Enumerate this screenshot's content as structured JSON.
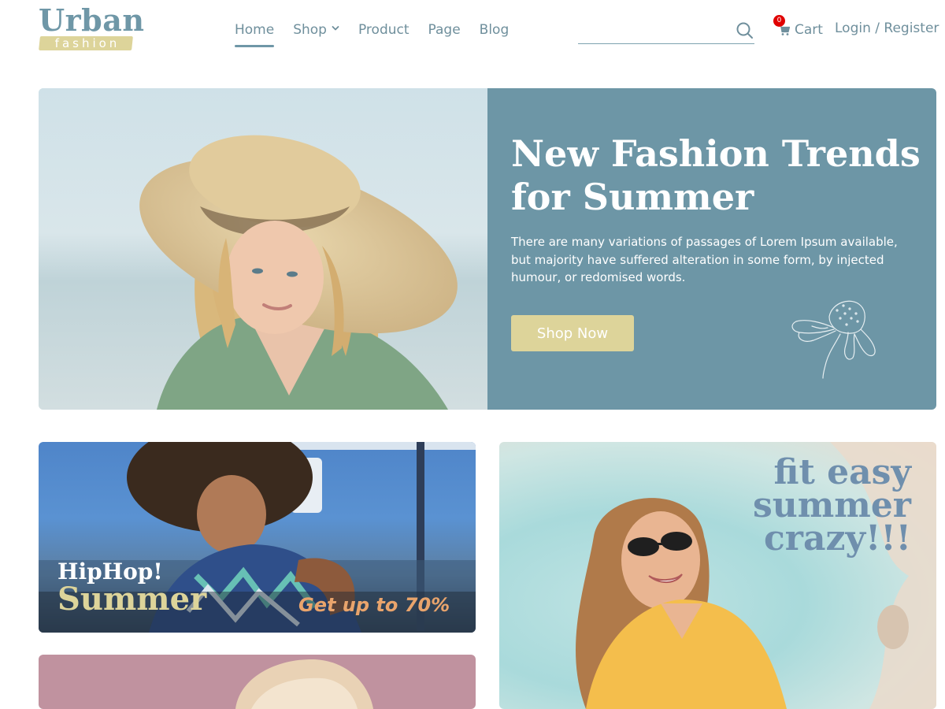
{
  "brand": {
    "name": "Urban",
    "tagline": "fashion"
  },
  "nav": {
    "items": [
      {
        "label": "Home",
        "active": true
      },
      {
        "label": "Shop",
        "has_dropdown": true
      },
      {
        "label": "Product"
      },
      {
        "label": "Page"
      },
      {
        "label": "Blog"
      }
    ]
  },
  "search": {
    "placeholder": ""
  },
  "cart": {
    "label": "Cart",
    "count": "0"
  },
  "auth": {
    "label": "Login / Register"
  },
  "hero": {
    "title": "New Fashion Trends for Summer",
    "description": "There are many variations of passages of Lorem Ipsum available, but majority have suffered alteration in some form, by injected humour, or redomised words.",
    "button_label": "Shop Now"
  },
  "promos": {
    "hiphop": {
      "title_line1": "HipHop!",
      "title_line2": "Summer",
      "offer": "Get up to 70%"
    },
    "summer": {
      "text": "fit easy summer crazy!!!"
    }
  },
  "colors": {
    "accent": "#6d96a6",
    "gold": "#ddd49a",
    "badge": "#e00000",
    "offer": "#e9a46c"
  }
}
